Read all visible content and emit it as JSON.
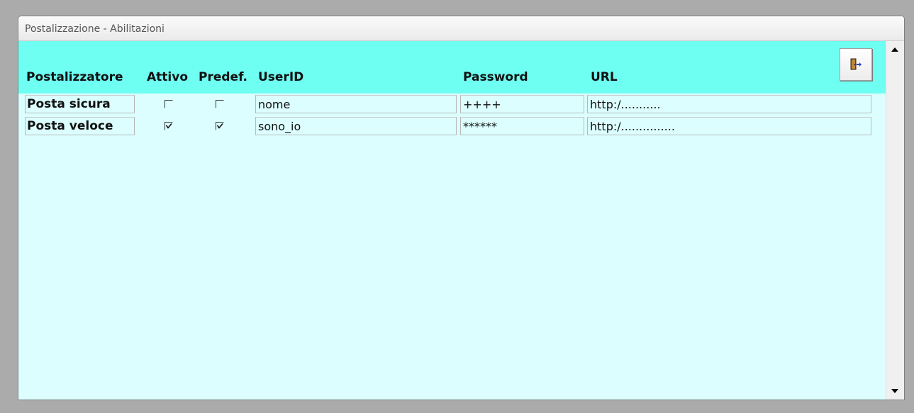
{
  "window": {
    "title": "Postalizzazione - Abilitazioni"
  },
  "columns": {
    "postalizzatore": "Postalizzatore",
    "attivo": "Attivo",
    "predef": "Predef.",
    "userid": "UserID",
    "password": "Password",
    "url": "URL"
  },
  "toolbar": {
    "exit_icon": "exit-door-icon"
  },
  "rows": [
    {
      "name": "Posta sicura",
      "attivo": false,
      "predef": false,
      "userid": "nome",
      "password": "++++",
      "url": "http:/..........."
    },
    {
      "name": "Posta veloce",
      "attivo": true,
      "predef": true,
      "userid": "sono_io",
      "password": "******",
      "url": "http:/..............."
    }
  ],
  "colors": {
    "header": "#6efff2",
    "background": "#dcfefe"
  }
}
